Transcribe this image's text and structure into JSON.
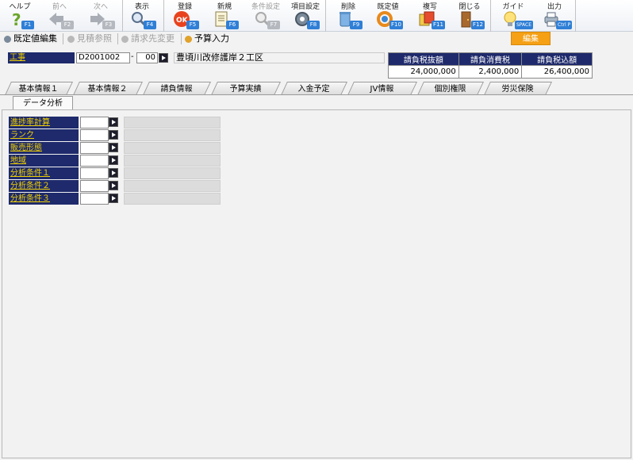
{
  "toolbar": {
    "buttons": [
      {
        "label": "ヘルプ",
        "key": "F1",
        "icon": "help-icon",
        "enabled": true
      },
      {
        "label": "前へ",
        "key": "F2",
        "icon": "arrow-left-icon",
        "enabled": false
      },
      {
        "label": "次へ",
        "key": "F3",
        "icon": "arrow-right-icon",
        "enabled": false
      },
      {
        "label": "表示",
        "key": "F4",
        "icon": "magnifier-icon",
        "enabled": true
      },
      {
        "label": "登録",
        "key": "F5",
        "icon": "ok-icon",
        "enabled": true
      },
      {
        "label": "新規",
        "key": "F6",
        "icon": "new-document-icon",
        "enabled": true
      },
      {
        "label": "条件設定",
        "key": "F7",
        "icon": "search-condition-icon",
        "enabled": false
      },
      {
        "label": "項目設定",
        "key": "F8",
        "icon": "item-settings-icon",
        "enabled": true
      },
      {
        "label": "削除",
        "key": "F9",
        "icon": "trash-icon",
        "enabled": true
      },
      {
        "label": "既定値",
        "key": "F10",
        "icon": "refresh-icon",
        "enabled": true
      },
      {
        "label": "複写",
        "key": "F11",
        "icon": "copy-icon",
        "enabled": true
      },
      {
        "label": "閉じる",
        "key": "F12",
        "icon": "door-icon",
        "enabled": true
      },
      {
        "label": "ガイド",
        "key": "SPACE",
        "icon": "bulb-icon",
        "enabled": true
      },
      {
        "label": "出力",
        "key": "Ctrl P",
        "icon": "printer-icon",
        "enabled": true
      }
    ]
  },
  "actions": {
    "default_edit": "既定値編集",
    "estimate_ref": "見積参照",
    "billing_change": "請求先変更",
    "budget_input": "予算入力",
    "mode": "編集"
  },
  "header": {
    "koji_label": "工事",
    "koji_code": "D2001002",
    "dash": "-",
    "koji_branch": "00",
    "koji_name": "豊頃川改修護岸２工区",
    "amounts": {
      "headers": [
        "請負税抜額",
        "請負消費税",
        "請負税込額"
      ],
      "values": [
        "24,000,000",
        "2,400,000",
        "26,400,000"
      ]
    }
  },
  "tabs": [
    "基本情報１",
    "基本情報２",
    "請負情報",
    "予算実績",
    "入金予定",
    "JV情報",
    "個別権限",
    "労災保険"
  ],
  "subtab": "データ分析",
  "rows": [
    {
      "label": "進捗率計算"
    },
    {
      "label": "ランク"
    },
    {
      "label": "販売形態"
    },
    {
      "label": "地域"
    },
    {
      "label": "分析条件１"
    },
    {
      "label": "分析条件２"
    },
    {
      "label": "分析条件３"
    }
  ],
  "colors": {
    "label_bg": "#1e2a6b",
    "label_fg": "#f0d000",
    "mode_badge": "#f5a015",
    "fkey": "#2f7fd6"
  }
}
